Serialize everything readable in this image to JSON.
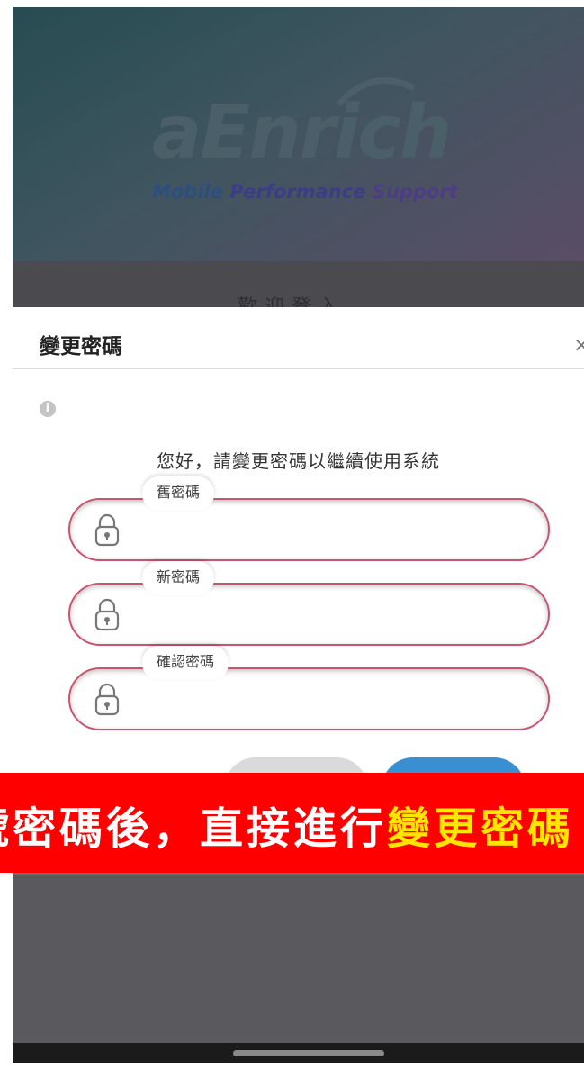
{
  "banner": {
    "logo": "aEnrich",
    "tagline_1": "Mobile ",
    "tagline_2": "Performance ",
    "tagline_3": "Support"
  },
  "welcome_text": "歡迎登入",
  "dialog": {
    "title": "變更密碼",
    "close": "×",
    "info": "i",
    "prompt": "您好，請變更密碼以繼續使用系統",
    "fields": [
      {
        "label": "舊密碼",
        "value": ""
      },
      {
        "label": "新密碼",
        "value": ""
      },
      {
        "label": "確認密碼",
        "value": ""
      }
    ]
  },
  "caption": {
    "part1": "號密碼後，直接進行",
    "part2": "變更密碼"
  },
  "colors": {
    "caption_bg": "#ff0000",
    "field_border": "#c9546f",
    "ok_button": "#3a8fd3"
  }
}
